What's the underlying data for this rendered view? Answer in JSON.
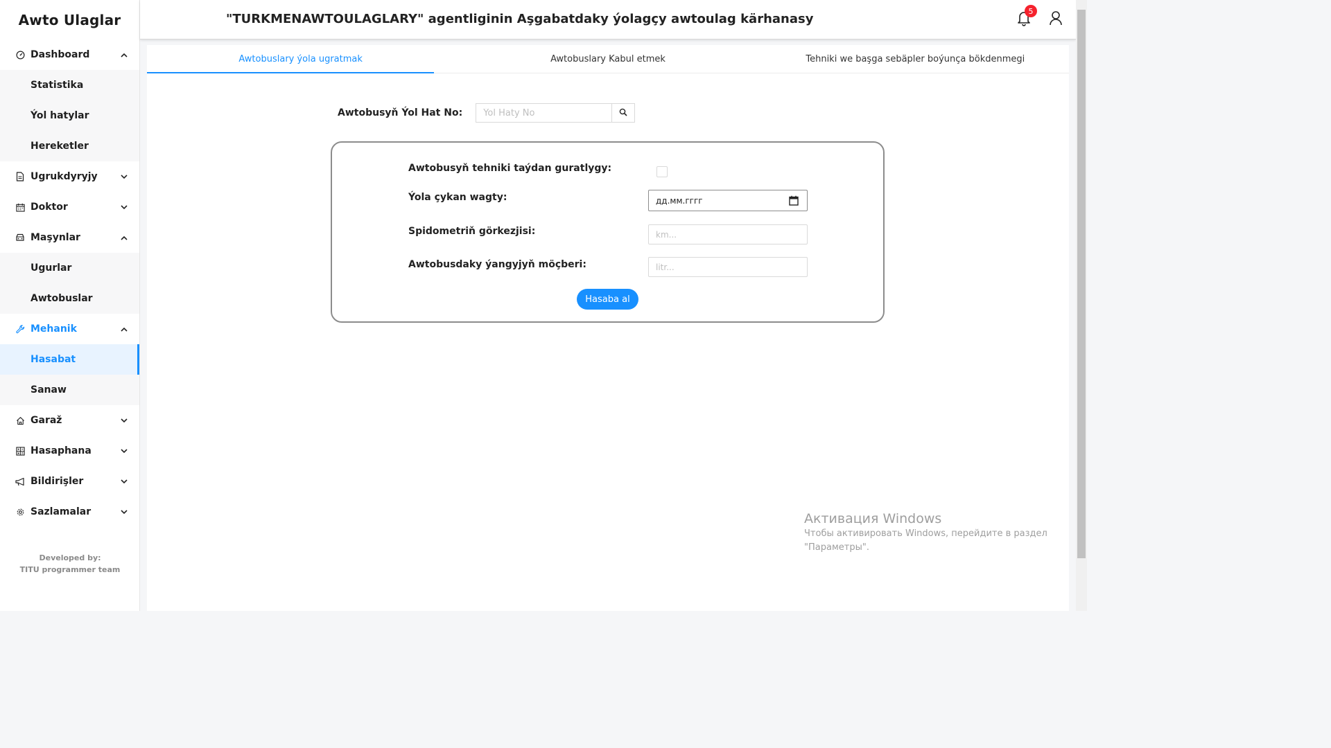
{
  "app": {
    "brand": "Awto Ulaglar",
    "title": "\"TURKMENAWTOULAGLARY\" agentliginin Aşgabatdaky ýolagçy awtoulag kärhanasy",
    "notification_count": "5"
  },
  "sidebar": {
    "items": [
      {
        "label": "Dashboard",
        "icon": "dashboard-icon",
        "expanded": true
      },
      {
        "label": "Statistika"
      },
      {
        "label": "Ýol hatylar"
      },
      {
        "label": "Hereketler"
      },
      {
        "label": "Ugrukdyryjy",
        "icon": "document-icon",
        "expanded": false
      },
      {
        "label": "Doktor",
        "icon": "calendar-icon",
        "expanded": false
      },
      {
        "label": "Maşynlar",
        "icon": "car-icon",
        "expanded": true
      },
      {
        "label": "Ugurlar"
      },
      {
        "label": "Awtobuslar"
      },
      {
        "label": "Mehanik",
        "icon": "wrench-icon",
        "expanded": true,
        "active": true
      },
      {
        "label": "Hasabat",
        "selected": true
      },
      {
        "label": "Sanaw"
      },
      {
        "label": "Garaž",
        "icon": "home-icon",
        "expanded": false
      },
      {
        "label": "Hasaphana",
        "icon": "calculator-icon",
        "expanded": false
      },
      {
        "label": "Bildirişler",
        "icon": "megaphone-icon",
        "expanded": false
      },
      {
        "label": "Sazlamalar",
        "icon": "gear-icon",
        "expanded": false
      }
    ],
    "footer_line1": "Developed by:",
    "footer_line2": "TITU programmer team"
  },
  "tabs": [
    {
      "label": "Awtobuslary ýola ugratmak",
      "active": true
    },
    {
      "label": "Awtobuslary Kabul etmek"
    },
    {
      "label": "Tehniki we başga sebäpler boýunça bökdenmegi"
    }
  ],
  "search": {
    "label": "Awtobusyň Ýol Hat No:",
    "placeholder": "Ýol Haty No",
    "value": ""
  },
  "form": {
    "technical_label": "Awtobusyň tehniki taýdan guratlygy:",
    "technical_checked": false,
    "departure_label": "Ýola çykan wagty:",
    "departure_value": "дд.мм.гггг",
    "speedometer_label": "Spidometriň görkezjisi:",
    "speedometer_placeholder": "km...",
    "fuel_label": "Awtobusdaky ýangyjyň möçberi:",
    "fuel_placeholder": "litr...",
    "submit_label": "Hasaba al"
  },
  "watermark": {
    "title": "Активация Windows",
    "line1": "Чтобы активировать Windows, перейдите в раздел",
    "line2": "\"Параметры\"."
  },
  "colors": {
    "accent": "#1890ff",
    "badge": "#f5222d",
    "sidebar_selected_bg": "#e8f3ff"
  }
}
